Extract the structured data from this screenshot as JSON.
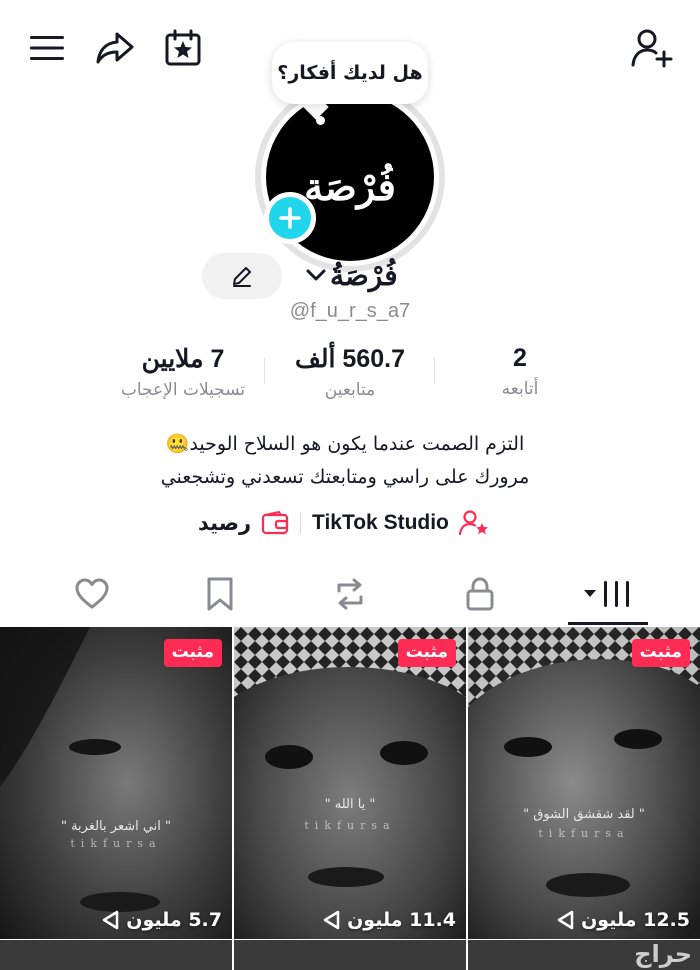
{
  "header": {
    "icons": [
      "menu-icon",
      "share-icon",
      "calendar-star-icon",
      "add-user-icon"
    ]
  },
  "bubble": {
    "text": "هل لديك أفكار؟"
  },
  "profile": {
    "avatar_text": "فُرْصَة",
    "name": "فُرْصَةُ",
    "handle": "@f_u_r_s_a7"
  },
  "stats": {
    "following": {
      "value": "2",
      "label": "أتابعه"
    },
    "followers": {
      "value": "560.7 ألف",
      "label": "متابعين"
    },
    "likes": {
      "value": "7 ملايين",
      "label": "تسجيلات الإعجاب"
    }
  },
  "bio": {
    "line1": "التزم الصمت عندما يكون هو السلاح الوحيد🤐",
    "line2": "مرورك على راسي ومتابعتك تسعدني وتشجعني"
  },
  "links": {
    "studio": "TikTok Studio",
    "balance": "رصيد"
  },
  "tabs": [
    "videos-grid-icon",
    "lock-icon",
    "repost-icon",
    "bookmark-icon",
    "heart-icon"
  ],
  "colors": {
    "accent": "#fe2c55",
    "plus": "#20d5ec",
    "text": "#161823",
    "muted": "#8a8b91"
  },
  "videos": [
    {
      "badge": "مثبت",
      "views": "12.5 مليون",
      "quote": "\" لقد شقشق الشوق \"",
      "watermark": "tikfursa"
    },
    {
      "badge": "مثبت",
      "views": "11.4 مليون",
      "quote": "\" يا الله \"",
      "watermark": "tikfursa"
    },
    {
      "badge": "مثبت",
      "views": "5.7 مليون",
      "quote": "\" اني اشعر بالغربة \"",
      "watermark": "tikfursa"
    }
  ],
  "site_watermark": "حراج"
}
